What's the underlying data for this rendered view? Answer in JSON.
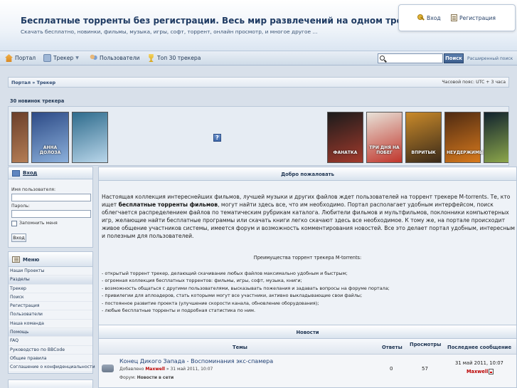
{
  "header": {
    "title": "Бесплатные торренты без регистрации. Весь мир развлечений на одном трекере.",
    "subtitle": "Скачать бесплатно, новинки, фильмы, музыка, игры, софт, торрент, онлайн просмотр, и многое другое ...",
    "login_label": "Вход",
    "register_label": "Регистрация"
  },
  "nav": {
    "items": [
      {
        "label": "Портал",
        "icon": "home-icon"
      },
      {
        "label": "Трекер",
        "icon": "tracker-icon"
      },
      {
        "label": "Пользователи",
        "icon": "users-icon"
      },
      {
        "label": "Топ 30 трекера",
        "icon": "trophy-icon"
      }
    ],
    "search_placeholder": "",
    "search_button": "Поиск",
    "advanced_search": "Расширенный поиск"
  },
  "breadcrumb": {
    "path": "Портал » Трекер",
    "timezone": "Часовой пояс: UTC + 3 часа"
  },
  "new_torrents": {
    "title": "30 новинок трекера",
    "posters": [
      {
        "title": "",
        "colors": [
          "#6b3f2a",
          "#b47d55"
        ]
      },
      {
        "title": "АННА ДОЛОЗА",
        "colors": [
          "#2c4a86",
          "#8cb0db"
        ]
      },
      {
        "title": "",
        "colors": [
          "#2e6b8c",
          "#b9d6ea"
        ]
      },
      {
        "title": "ФАНАТКА",
        "colors": [
          "#1b1b1b",
          "#a23a2c"
        ]
      },
      {
        "title": "ТРИ ДНЯ НА ПОБЕГ",
        "colors": [
          "#e8e2d8",
          "#c0362c"
        ]
      },
      {
        "title": "ВПРИТЫК",
        "colors": [
          "#c98a2a",
          "#3a2a1a"
        ]
      },
      {
        "title": "НЕУДЕРЖИМЫЕ",
        "colors": [
          "#4e2a12",
          "#d87a1d"
        ]
      },
      {
        "title": "",
        "colors": [
          "#10222e",
          "#8fa94b"
        ]
      }
    ]
  },
  "sidebar": {
    "login": {
      "title": "Вход",
      "username_label": "Имя пользователя:",
      "password_label": "Пароль:",
      "remember_label": "Запомнить меня",
      "submit_label": "Вход"
    },
    "menu": {
      "title": "Меню",
      "items": [
        {
          "label": "Наши Проекты",
          "section": false
        },
        {
          "label": "Разделы",
          "section": true
        },
        {
          "label": "Трекер",
          "section": false
        },
        {
          "label": "Поиск",
          "section": false
        },
        {
          "label": "Регистрация",
          "section": false
        },
        {
          "label": "Пользователи",
          "section": false
        },
        {
          "label": "Наша команда",
          "section": false
        },
        {
          "label": "Помощь",
          "section": true
        },
        {
          "label": "FAQ",
          "section": false
        },
        {
          "label": "Руководство по BBCode",
          "section": false
        },
        {
          "label": "Общие правила",
          "section": false
        },
        {
          "label": "Соглашение о конфиденциальности",
          "section": false
        }
      ]
    }
  },
  "welcome": {
    "title": "Добро пожаловать",
    "intro_1": "Настоящая коллекция интереснейших фильмов, лучшей музыки и других файлов ждет пользователей на торрент трекере M-torrents. Те, кто ищет",
    "intro_bold": "бесплатные торренты фильмов",
    "intro_2": ", могут найти здесь все, что им необходимо. Портал располагает удобным интерфейсом, поиск облегчается распределением файлов по тематическим рубрикам каталога. Любители фильмов и мультфильмов, поклонники компьютерных игр, желающие найти бесплатные программы или скачать книги легко скачают здесь все необходимое. К тому же, на портале происходит живое общение участников системы, имеется форум и возможность комментирования новостей. Все это делает портал удобным, интересным и полезным для пользователей.",
    "advantages_title": "Преимущества торрент трекера M-torrents:",
    "advantages": [
      "- открытый торрент трекер, делающий скачивание любых файлов максимально удобным и быстрым;",
      "- огромная коллекция бесплатных торрентов: фильмы, игры, софт, музыка, книги;",
      "- возможность общаться с другими пользователями, высказывать пожелания и задавать вопросы на форуме портала;",
      "- привилегии для аплоадеров, стать которыми могут все участники, активно выкладывающие свои файлы;",
      "- постоянное развитие проекта (улучшение скорости канала, обновление оборудования);",
      "- любые бесплатные торренты и подробная статистика по ним."
    ]
  },
  "news": {
    "title": "Новости",
    "columns": {
      "topics": "Темы",
      "replies": "Ответы",
      "views": "Просмотры",
      "last_post": "Последнее сообщение"
    },
    "rows": [
      {
        "topic": "Конец Дикого Запада - Воспоминания экс-спамера",
        "added_prefix": "Добавлено",
        "author": "Maxwell",
        "added_date": " » 31 май 2011, 10:07",
        "forum_prefix": "Форум: ",
        "forum": "Новости в сети",
        "replies": "0",
        "views": "57",
        "last_date": "31 май 2011, 10:07",
        "last_user": "Maxwell"
      }
    ]
  },
  "colors": {
    "header_title": "#1f3b63",
    "link": "#1e3f73",
    "author": "#bb0000"
  }
}
